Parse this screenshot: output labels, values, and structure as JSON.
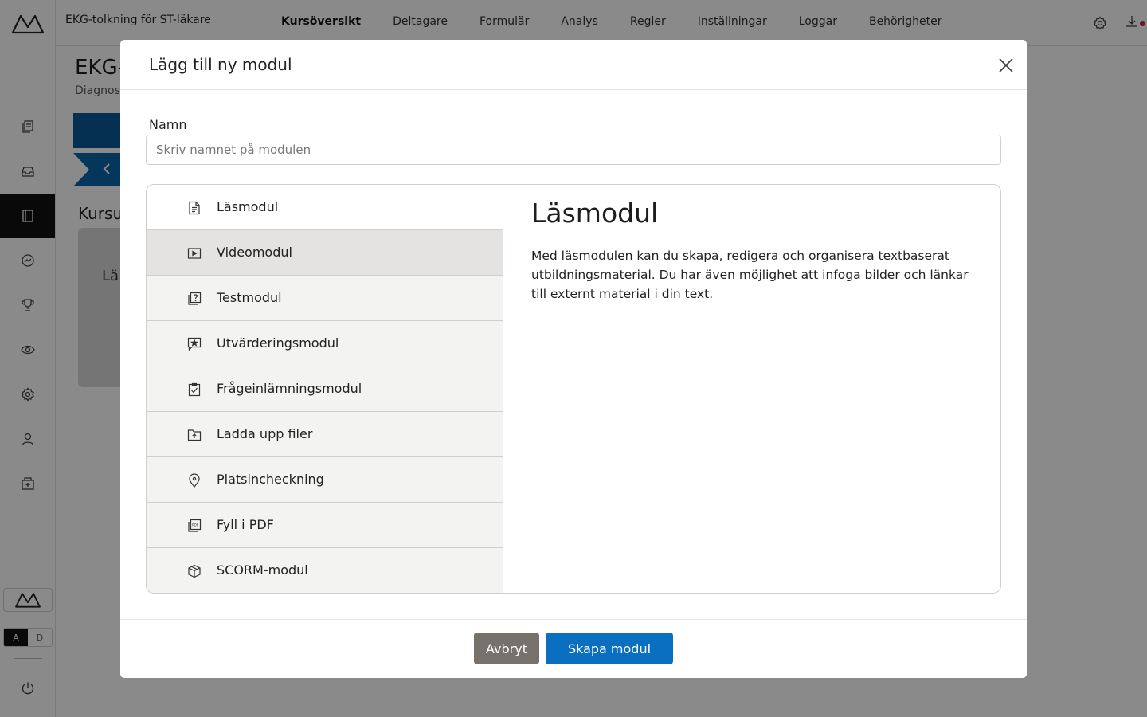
{
  "app": {
    "course_title": "EKG-tolkning för ST-läkare",
    "nav": [
      {
        "label": "Kursöversikt",
        "current": true
      },
      {
        "label": "Deltagare"
      },
      {
        "label": "Formulär"
      },
      {
        "label": "Analys"
      },
      {
        "label": "Regler"
      },
      {
        "label": "Inställningar"
      },
      {
        "label": "Loggar"
      },
      {
        "label": "Behörigheter"
      }
    ],
    "page_heading": "EKG-",
    "page_subtitle": "Diagnos",
    "section_label": "Kursu",
    "card_text": "Lä",
    "toggle": {
      "a": "A",
      "d": "D"
    },
    "accent_color": "#0a66ad",
    "notification_color": "#d92b2b"
  },
  "modal": {
    "title": "Lägg till ny modul",
    "name_label": "Namn",
    "name_placeholder": "Skriv namnet på modulen",
    "name_value": "",
    "module_types": [
      {
        "label": "Läsmodul",
        "icon": "document-icon"
      },
      {
        "label": "Videomodul",
        "icon": "video-icon"
      },
      {
        "label": "Testmodul",
        "icon": "quiz-icon"
      },
      {
        "label": "Utvärderingsmodul",
        "icon": "star-comment-icon"
      },
      {
        "label": "Frågeinlämningsmodul",
        "icon": "clipboard-check-icon"
      },
      {
        "label": "Ladda upp filer",
        "icon": "folder-upload-icon"
      },
      {
        "label": "Platsincheckning",
        "icon": "location-pin-icon"
      },
      {
        "label": "Fyll i PDF",
        "icon": "pdf-icon"
      },
      {
        "label": "SCORM-modul",
        "icon": "package-icon"
      }
    ],
    "selected_type": {
      "title": "Läsmodul",
      "description": "Med läsmodulen kan du skapa, redigera och organisera textbaserat utbildningsmaterial. Du har även möjlighet att infoga bilder och länkar till externt material i din text."
    },
    "cancel_label": "Avbryt",
    "create_label": "Skapa modul",
    "cancel_color": "#77716c",
    "create_color": "#0a6fc0"
  }
}
